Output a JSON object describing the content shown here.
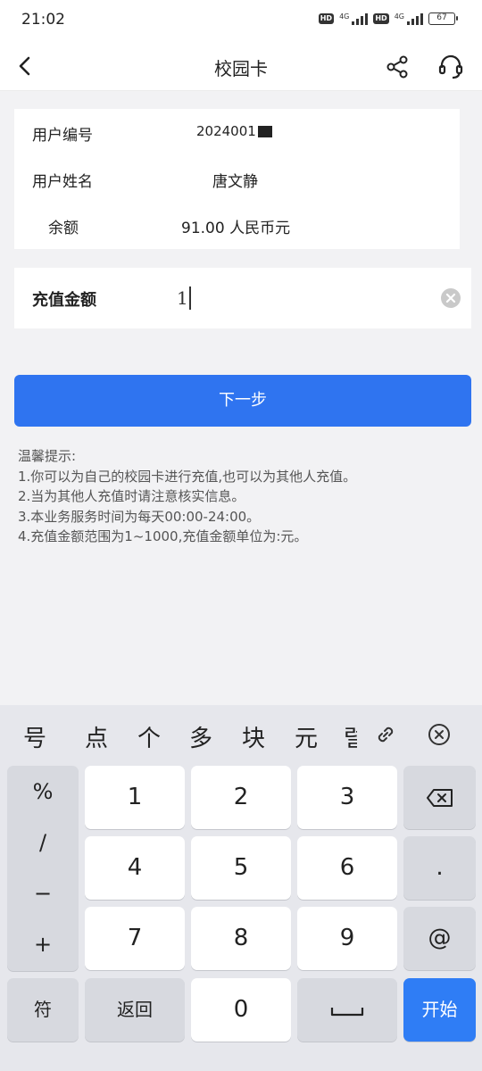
{
  "status_bar": {
    "time": "21:02",
    "network_1": "4G",
    "network_2": "4G",
    "hd_1": "HD",
    "hd_2": "HD",
    "battery": "67"
  },
  "nav": {
    "title": "校园卡",
    "back_icon": "chevron-left-icon",
    "share_icon": "share-icon",
    "service_icon": "headset-icon"
  },
  "info": {
    "user_id_label": "用户编号",
    "user_id_value": "2024001",
    "user_name_label": "用户姓名",
    "user_name_value": "唐文静",
    "balance_label": "余额",
    "balance_value": "91.00 人民币元"
  },
  "recharge": {
    "label": "充值金额",
    "value": "1"
  },
  "next_button": {
    "label": "下一步"
  },
  "tips": {
    "title": "温馨提示:",
    "lines": [
      "1.你可以为自己的校园卡进行充值,也可以为其他人充值。",
      "2.当为其他人充值时请注意核实信息。",
      "3.本业务服务时间为每天00:00-24:00。",
      "4.充值金额范围为1~1000,充值金额单位为:元。"
    ]
  },
  "keyboard": {
    "candidates": [
      "号",
      "点",
      "个",
      "多",
      "块",
      "元",
      "럴"
    ],
    "symbols": [
      "%",
      "/",
      "−",
      "+"
    ],
    "digits": [
      "1",
      "2",
      "3",
      "4",
      "5",
      "6",
      "7",
      "8",
      "9",
      "0"
    ],
    "dot": ".",
    "at": "@",
    "symbol_key": "符",
    "return_key": "返回",
    "start_key": "开始",
    "backspace_icon": "backspace-icon",
    "space_icon": "space-icon",
    "clip_icon": "link-icon",
    "close_icon": "close-circle-icon"
  }
}
